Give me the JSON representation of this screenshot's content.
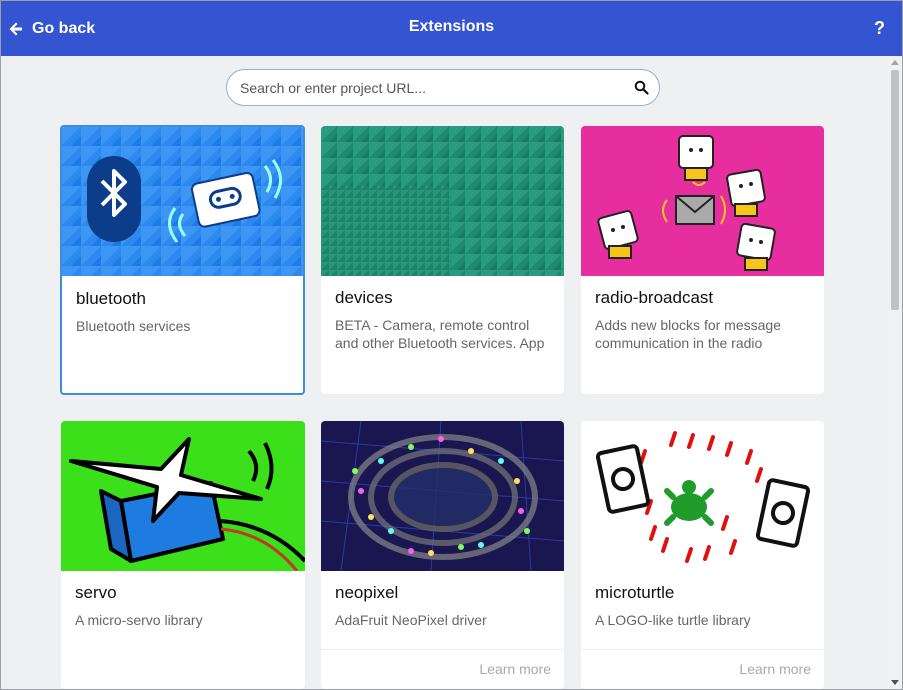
{
  "header": {
    "back_label": "Go back",
    "title": "Extensions",
    "help_label": "?"
  },
  "search": {
    "placeholder": "Search or enter project URL..."
  },
  "colors": {
    "header_bg": "#3454d1",
    "accent_border": "#3c8de0",
    "bluetooth_bg": "#2b89f0",
    "devices_bg": "#1f8a70",
    "radio_bg": "#e62e9e",
    "servo_bg": "#3be01a"
  },
  "extensions": [
    {
      "name": "bluetooth",
      "description": "Bluetooth services",
      "selected": true
    },
    {
      "name": "devices",
      "description": "BETA - Camera, remote control and other Bluetooth services. App"
    },
    {
      "name": "radio-broadcast",
      "description": "Adds new blocks for message communication in the radio"
    },
    {
      "name": "servo",
      "description": "A micro-servo library"
    },
    {
      "name": "neopixel",
      "description": "AdaFruit NeoPixel driver",
      "learn_more": "Learn more"
    },
    {
      "name": "microturtle",
      "description": "A LOGO-like turtle library",
      "learn_more": "Learn more"
    }
  ]
}
